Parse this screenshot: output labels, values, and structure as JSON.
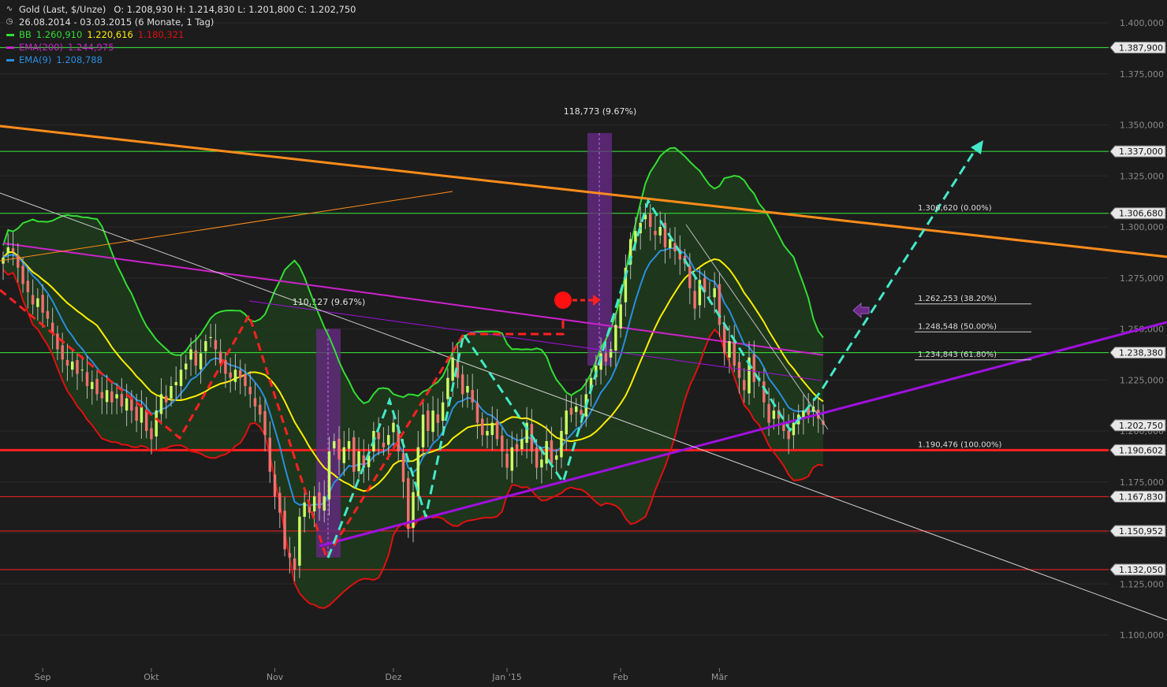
{
  "legend": {
    "instrument": "Gold (Last, $/Unze)",
    "ohlc": "O: 1.208,930  H: 1.214,830  L: 1.201,800  C: 1.202,750",
    "range": "26.08.2014 - 03.03.2015 (6 Monate, 1 Tag)",
    "bb_label": "BB",
    "bb_mid": "1.260,910",
    "bb_upper": "1.220,616",
    "bb_lower": "1.180,321",
    "ema200_label": "EMA(200)",
    "ema200_value": "1.244,975",
    "ema9_label": "EMA(9)",
    "ema9_value": "1.208,788"
  },
  "colors": {
    "background": "#1c1c1c",
    "bb_upper": "#33dd33",
    "bb_lower": "#e01010",
    "bb_mid": "#ffee00",
    "bb_fill": "#1f3a1c",
    "ema200": "#cc22cc",
    "ema9": "#2a8ee0",
    "candle_up": "#ccff66",
    "candle_down": "#f07070",
    "support_red": "#ff2020",
    "trend_orange": "#ff8c1a",
    "trend_purple": "#a010e0",
    "pattern_cyan": "#44e8c8",
    "marker_purple": "#6a2a8a",
    "resistance_green": "#3aeb3a"
  },
  "chart_data": {
    "type": "candlestick",
    "title": "Gold (Last, $/Unze)",
    "ylim": [
      1090,
      1410
    ],
    "y_ticks": [
      "1.400,000",
      "1.375,000",
      "1.350,000",
      "1.325,000",
      "1.300,000",
      "1.275,000",
      "1.250,000",
      "1.225,000",
      "1.200,000",
      "1.175,000",
      "1.150,000",
      "1.125,000",
      "1.100,000"
    ],
    "x_labels": [
      "Sep",
      "Okt",
      "Nov",
      "Dez",
      "Jan '15",
      "Feb",
      "Mär"
    ],
    "price_levels": [
      {
        "label": "1.387,900",
        "value": 1387.9,
        "color": "green"
      },
      {
        "label": "1.337,000",
        "value": 1337.0,
        "color": "green"
      },
      {
        "label": "1.306,680",
        "value": 1306.68,
        "color": "green"
      },
      {
        "label": "1.238,380",
        "value": 1238.38,
        "color": "green"
      },
      {
        "label": "1.202,750",
        "value": 1202.75,
        "color": "current"
      },
      {
        "label": "1.190,602",
        "value": 1190.602,
        "color": "red_thick"
      },
      {
        "label": "1.167,830",
        "value": 1167.83,
        "color": "red"
      },
      {
        "label": "1.150,952",
        "value": 1150.952,
        "color": "red"
      },
      {
        "label": "1.132,050",
        "value": 1132.05,
        "color": "red"
      }
    ],
    "fibonacci": [
      {
        "label": "1.306,620 (0.00%)",
        "value": 1306.62
      },
      {
        "label": "1.262,253 (38.20%)",
        "value": 1262.253
      },
      {
        "label": "1.248,548 (50.00%)",
        "value": 1248.548
      },
      {
        "label": "1.234,843 (61.80%)",
        "value": 1234.843
      },
      {
        "label": "1.190,476 (100.00%)",
        "value": 1190.476
      }
    ],
    "annotations": [
      {
        "label": "110,127 (9.67%)"
      },
      {
        "label": "118,773 (9.67%)"
      }
    ],
    "close_series": [
      1285,
      1290,
      1288,
      1280,
      1272,
      1268,
      1262,
      1265,
      1258,
      1255,
      1248,
      1240,
      1235,
      1232,
      1234,
      1228,
      1230,
      1222,
      1224,
      1218,
      1216,
      1220,
      1214,
      1218,
      1212,
      1216,
      1210,
      1205,
      1212,
      1200,
      1196,
      1210,
      1218,
      1214,
      1222,
      1224,
      1230,
      1233,
      1240,
      1232,
      1238,
      1244,
      1246,
      1240,
      1233,
      1228,
      1226,
      1230,
      1226,
      1222,
      1218,
      1212,
      1208,
      1198,
      1180,
      1168,
      1160,
      1142,
      1138,
      1132,
      1158,
      1165,
      1160,
      1168,
      1162,
      1168,
      1190,
      1195,
      1186,
      1192,
      1195,
      1180,
      1190,
      1182,
      1188,
      1200,
      1196,
      1192,
      1198,
      1204,
      1190,
      1175,
      1152,
      1170,
      1192,
      1208,
      1200,
      1210,
      1204,
      1214,
      1226,
      1236,
      1226,
      1218,
      1222,
      1214,
      1204,
      1198,
      1200,
      1204,
      1196,
      1190,
      1182,
      1192,
      1190,
      1196,
      1204,
      1190,
      1182,
      1186,
      1195,
      1184,
      1188,
      1200,
      1210,
      1208,
      1212,
      1208,
      1218,
      1226,
      1232,
      1238,
      1234,
      1240,
      1252,
      1262,
      1280,
      1294,
      1298,
      1302,
      1306,
      1300,
      1296,
      1300,
      1290,
      1294,
      1288,
      1284,
      1282,
      1270,
      1260,
      1274,
      1268,
      1266,
      1270,
      1252,
      1238,
      1244,
      1232,
      1226,
      1220,
      1236,
      1224,
      1226,
      1214,
      1204,
      1210,
      1206,
      1200,
      1196,
      1204,
      1208,
      1210,
      1208,
      1212,
      1206,
      1203
    ]
  }
}
